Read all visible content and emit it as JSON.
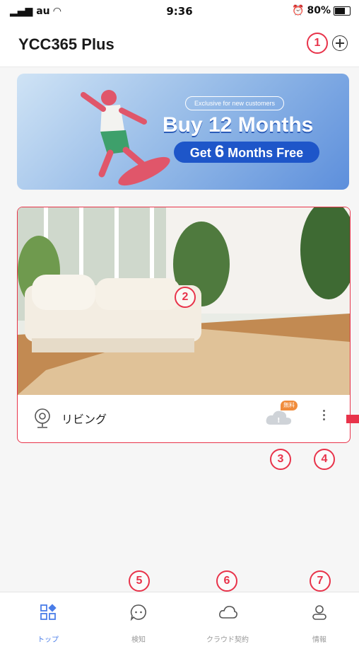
{
  "status_bar": {
    "carrier": "au",
    "time": "9:36",
    "battery": "80%"
  },
  "header": {
    "title": "YCC365 Plus"
  },
  "banner": {
    "tag": "Exclusive for new customers",
    "headline": "Buy 12 Months",
    "sub_prefix": "Get ",
    "sub_number": "6",
    "sub_suffix": " Months Free"
  },
  "camera": {
    "name": "リビング",
    "cloud_badge": "無料"
  },
  "markers": [
    "1",
    "2",
    "3",
    "4",
    "5",
    "6",
    "7"
  ],
  "tabs": [
    {
      "label": "トップ",
      "icon": "grid-icon",
      "active": true
    },
    {
      "label": "検知",
      "icon": "chat-bubble-icon",
      "active": false
    },
    {
      "label": "クラウド契約",
      "icon": "cloud-icon",
      "active": false
    },
    {
      "label": "情報",
      "icon": "user-icon",
      "active": false
    }
  ],
  "colors": {
    "accent": "#4a7de8",
    "annotation": "#e8334a",
    "badge": "#f08c3c"
  }
}
